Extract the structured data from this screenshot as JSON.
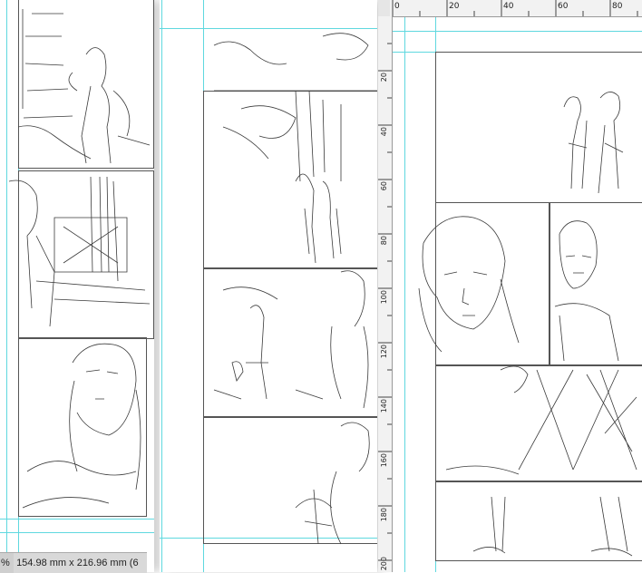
{
  "status_bar": {
    "zoom_suffix": "%",
    "canvas_size": "154.98 mm x 216.96 mm (6"
  },
  "ruler": {
    "top_labels": [
      "0",
      "20",
      "40",
      "60",
      "80"
    ],
    "left_labels": [
      "20",
      "40",
      "60",
      "80",
      "100",
      "120",
      "140",
      "160",
      "180",
      "200"
    ]
  },
  "colors": {
    "guide": "#5fd8df",
    "panel_border": "#555555",
    "sketch_stroke": "#3a3a3a",
    "ruler_bg": "#f2f2f2",
    "status_bg": "#d9d9d9"
  }
}
